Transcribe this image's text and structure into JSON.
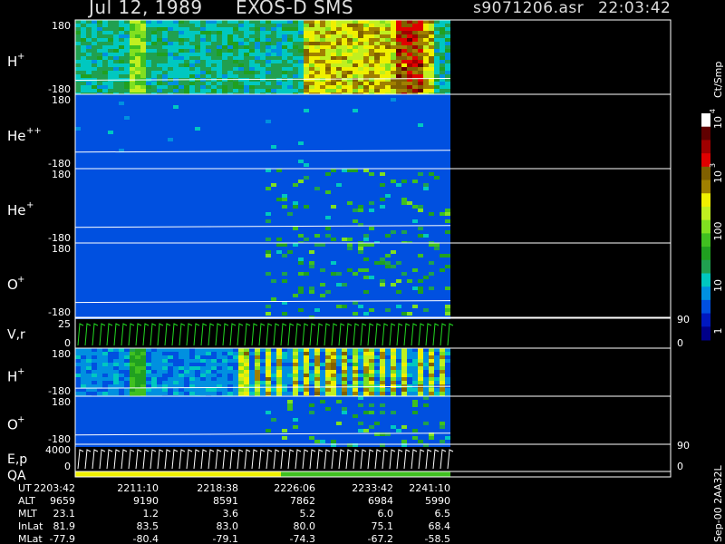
{
  "header": {
    "date": "Jul 12, 1989",
    "instrument": "EXOS-D SMS",
    "file": "s9071206.asr",
    "time": "22:03:42"
  },
  "colors": {
    "background": "#000000",
    "plot_bg": "#1a2a8a",
    "frame": "#ffffff",
    "trace": "#ffffff",
    "vr_trace": "#22dd22",
    "ep_trace": "#ffffff"
  },
  "colorbar": {
    "unit": "Ct/Smp",
    "ticks": [
      "1",
      "10",
      "100",
      "10",
      "10"
    ],
    "tick_exps": [
      "",
      "",
      "",
      "3",
      "4"
    ],
    "stops": [
      "#000088",
      "#0018c0",
      "#0050e0",
      "#0090e0",
      "#00c8c0",
      "#20a050",
      "#20a020",
      "#40c020",
      "#80e020",
      "#c0f020",
      "#f0f000",
      "#a08000",
      "#806000",
      "#e00000",
      "#a00000",
      "#600000",
      "#ffffff"
    ]
  },
  "chart_data": [
    {
      "type": "heatmap",
      "panel": "H+ (spin angle)",
      "ylabel_base": "H",
      "ylabel_sup": "+",
      "ytop": "180",
      "ybot": "-180",
      "ylim": [
        -180,
        180
      ],
      "intensity": "high",
      "trace_level": -112
    },
    {
      "type": "heatmap",
      "panel": "He++ (spin angle)",
      "ylabel_base": "He",
      "ylabel_sup": "++",
      "ytop": "180",
      "ybot": "-180",
      "ylim": [
        -180,
        180
      ],
      "intensity": "very low",
      "trace_level": -100
    },
    {
      "type": "heatmap",
      "panel": "He+ (spin angle)",
      "ylabel_base": "He",
      "ylabel_sup": "+",
      "ytop": "180",
      "ybot": "-180",
      "ylim": [
        -180,
        180
      ],
      "intensity": "low",
      "trace_level": -104
    },
    {
      "type": "heatmap",
      "panel": "O+ (spin angle)",
      "ylabel_base": "O",
      "ylabel_sup": "+",
      "ytop": "180",
      "ybot": "-180",
      "ylim": [
        -180,
        180
      ],
      "intensity": "low",
      "trace_level": -108
    },
    {
      "type": "line",
      "panel": "V,r",
      "ylabel": "V,r",
      "ytop": "25",
      "ybot": "0",
      "ylim": [
        0,
        25
      ],
      "right_top": "90",
      "right_bot": "0"
    },
    {
      "type": "heatmap",
      "panel": "H+ (pitch)",
      "ylabel_base": "H",
      "ylabel_sup": "+",
      "ytop": "180",
      "ybot": "-180",
      "ylim": [
        -180,
        180
      ],
      "intensity": "banded",
      "trace_level": -120
    },
    {
      "type": "heatmap",
      "panel": "O+ (pitch)",
      "ylabel_base": "O",
      "ylabel_sup": "+",
      "ytop": "180",
      "ybot": "-180",
      "ylim": [
        -180,
        180
      ],
      "intensity": "low",
      "trace_level": -110
    },
    {
      "type": "line",
      "panel": "E,p",
      "ylabel": "E,p",
      "ytop": "4000",
      "ybot": "0",
      "ylim": [
        0,
        4000
      ],
      "right_top": "90",
      "right_bot": "0"
    },
    {
      "type": "bar",
      "panel": "QA",
      "ylabel": "QA"
    }
  ],
  "xaxis": {
    "row_labels": [
      "UT",
      "ALT",
      "MLT",
      "InLat",
      "MLat"
    ],
    "columns": [
      [
        "2203:42",
        "9659",
        "23.1",
        "81.9",
        "-77.9"
      ],
      [
        "2211:10",
        "9190",
        "1.2",
        "83.5",
        "-80.4"
      ],
      [
        "2218:38",
        "8591",
        "3.6",
        "83.0",
        "-79.1"
      ],
      [
        "2226:06",
        "7862",
        "5.2",
        "80.0",
        "-74.3"
      ],
      [
        "2233:42",
        "6984",
        "6.0",
        "75.1",
        "-67.2"
      ],
      [
        "2241:10",
        "5990",
        "6.5",
        "68.4",
        "-58.5"
      ]
    ]
  },
  "footer_vertical": "Sep-00 2AA32L"
}
